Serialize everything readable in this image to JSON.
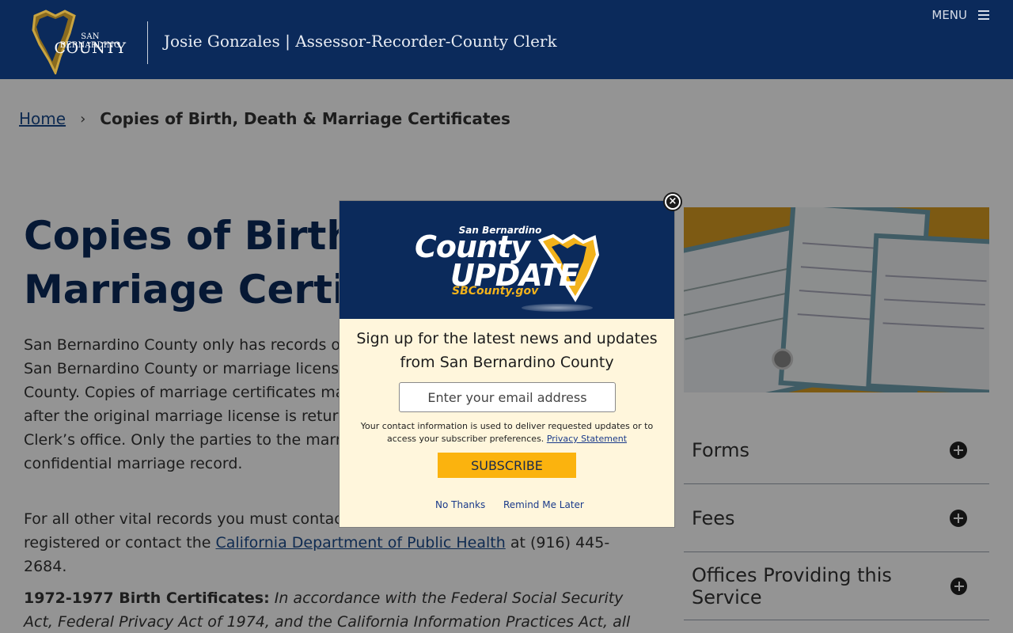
{
  "header": {
    "logo_line1": "SAN BERNARDINO",
    "logo_line2": "COUNTY",
    "title": "Josie Gonzales | Assessor-Recorder-County Clerk",
    "menu_label": "MENU",
    "menu_icon": "hamburger-icon"
  },
  "breadcrumb": {
    "home": "Home",
    "separator": "›",
    "current": "Copies of Birth, Death & Marriage Certificates"
  },
  "main": {
    "title": "Copies of Birth, Death & Marriage Certificates",
    "para1": "San Bernardino County only has records of births and deaths that occurred in San Bernardino County or marriage licenses that were issued in San Bernardino County. Copies of marriage certificates may be obtained approximately 2 weeks after the original marriage license is returned to the Assessor-Recorder-County Clerk’s office. Only the parties to the marriage may obtain a copy of a confidential marriage record.",
    "para2_pre": "For all other vital records you must contact the county where the event was registered or contact the ",
    "para2_link": "California Department of Public Health",
    "para2_post": " at (916) 445-2684.",
    "para3_lead": "1972-1977 Birth Certificates:",
    "para3_text": " In accordance with the Federal Social Security Act, Federal Privacy Act of 1974, and the California Information Practices Act, all social"
  },
  "sidebar": {
    "image_alt": "certificates-image",
    "accordion": [
      {
        "label": "Forms",
        "icon": "plus-circle-icon"
      },
      {
        "label": "Fees",
        "icon": "plus-circle-icon"
      },
      {
        "label": "Offices Providing this Service",
        "icon": "plus-circle-icon"
      }
    ]
  },
  "modal": {
    "banner_small": "San Bernardino",
    "banner_line1": "County",
    "banner_line2": "UPDATE",
    "banner_url": "SBCounty.gov",
    "heading": "Sign up for the latest news and updates from San Bernardino County",
    "email_placeholder": "Enter your email address",
    "disclaimer": "Your contact information is used to deliver requested updates or to access your subscriber preferences.",
    "privacy_link": "Privacy Statement",
    "subscribe_label": "SUBSCRIBE",
    "no_thanks": "No Thanks",
    "remind_later": "Remind Me Later",
    "close_icon": "close-icon"
  },
  "colors": {
    "navy": "#0b2a5b",
    "gold": "#fbb30e",
    "modal_bg": "#fff6dc",
    "link": "#1a4a8c"
  }
}
